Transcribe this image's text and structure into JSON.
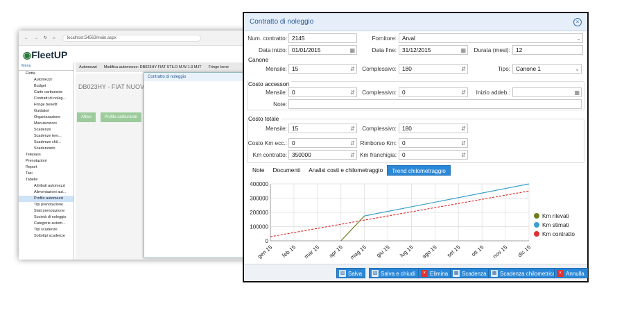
{
  "background_app": {
    "url": "localhost:54563/main.aspx",
    "brand": "FleetUP",
    "menu_label": "Menu",
    "menu_items": [
      "Flotta",
      "Automezzi",
      "Budget",
      "Carte carburante",
      "Contratti di noleg...",
      "Fringe benefit",
      "Guidatori",
      "Organizzazione",
      "Manutenzioni",
      "Scadenze",
      "Scadenze tem...",
      "Scadenze chil...",
      "Scadenzario",
      "Telepass",
      "Prenotazioni",
      "Report",
      "Taxi",
      "Tabelle",
      "Attributi automezzi",
      "Alimentazioni aut...",
      "Profilo automezzi",
      "Tipi prenotazione",
      "Stati prenotazione",
      "Società di noleggio",
      "Categorie autom...",
      "Tipi scadenze",
      "Sottotipi scadenze"
    ],
    "tabs": [
      "Automezzi",
      "Modifica automezzo: DB023HY FIAT STILO M.W 1.9 MJT",
      "Fringe bene"
    ],
    "vehicle_title": "DB023HY - FIAT NUOVA PA",
    "green_buttons": [
      "Attivo",
      "Profilo carburante"
    ],
    "mini_dialog_title": "Contratto di noleggio"
  },
  "dialog": {
    "title": "Contratto di noleggio",
    "num_contratto_label": "Num. contratto:",
    "num_contratto": "2145",
    "fornitore_label": "Fornitore:",
    "fornitore": "Arval",
    "data_inizio_label": "Data inizio:",
    "data_inizio": "01/01/2015",
    "data_fine_label": "Data fine:",
    "data_fine": "31/12/2015",
    "durata_label": "Durata (mesi):",
    "durata": "12",
    "canone_section": "Canone",
    "mensile_label": "Mensile:",
    "canone_mensile": "15",
    "complessivo_label": "Complessivo:",
    "canone_complessivo": "180",
    "tipo_label": "Tipo:",
    "tipo": "Canone 1",
    "costo_accessori_section": "Costo accessori",
    "acc_mensile": "0",
    "acc_complessivo": "0",
    "inizio_addeb_label": "Inizio addeb.:",
    "inizio_addeb": "",
    "note_label": "Note:",
    "note": "",
    "costo_totale_section": "Costo totale",
    "tot_mensile": "15",
    "tot_complessivo": "180",
    "costo_km_ecc_label": "Costo Km ecc.:",
    "costo_km_ecc": "0",
    "rimborso_km_label": "Rimborso Km:",
    "rimborso_km": "0",
    "km_contratto_label": "Km contratto:",
    "km_contratto": "350000",
    "km_franchigia_label": "Km franchigia:",
    "km_franchigia": "0",
    "tabs": [
      "Note",
      "Documenti",
      "Analisi costi e chilometraggio",
      "Trend chilometraggio"
    ],
    "buttons": {
      "salva": "Salva",
      "salva_chiudi": "Salva e chiudi",
      "elimina": "Elimina",
      "scadenza": "Scadenza",
      "scadenza_km": "Scadenza chilometrica",
      "annulla": "Annulla"
    }
  },
  "chart_data": {
    "type": "line",
    "categories": [
      "gen 15",
      "feb 15",
      "mar 15",
      "apr 15",
      "mag 15",
      "giu 15",
      "lug 15",
      "ago 15",
      "set 15",
      "ott 15",
      "nov 15",
      "dic 15"
    ],
    "ylim": [
      0,
      400000
    ],
    "yticks": [
      "0",
      "100000",
      "200000",
      "300000",
      "400000"
    ],
    "grid": true,
    "legend_position": "right",
    "series": [
      {
        "name": "Km rilevati",
        "color": "#6b7f1e",
        "style": "solid",
        "points": [
          [
            3,
            0
          ],
          [
            4,
            175000
          ]
        ]
      },
      {
        "name": "Km stimati",
        "color": "#3aa0cc",
        "style": "solid",
        "points": [
          [
            4,
            175000
          ],
          [
            11,
            400000
          ]
        ]
      },
      {
        "name": "Km contratto",
        "color": "#e03030",
        "style": "dashed",
        "points": [
          [
            0,
            29000
          ],
          [
            11,
            350000
          ]
        ]
      }
    ]
  }
}
